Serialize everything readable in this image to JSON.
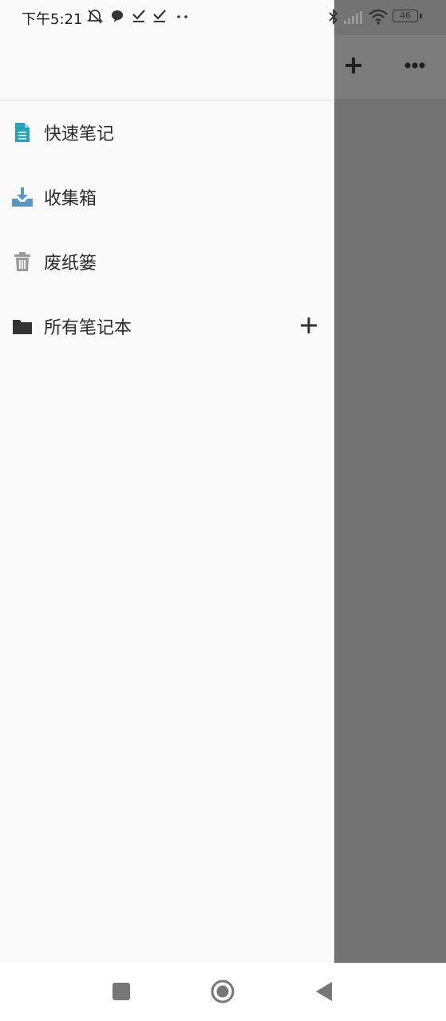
{
  "status_bar": {
    "time": "下午5:21",
    "battery": "46",
    "icons": [
      "mute-bell-icon",
      "chat-bubble-icon",
      "check-icon",
      "check-icon",
      "more-dots-icon",
      "bluetooth-icon",
      "signal-icon",
      "wifi-icon",
      "battery-icon"
    ]
  },
  "background_toolbar": {
    "icons": [
      "add-icon",
      "more-icon"
    ]
  },
  "drawer": {
    "items": [
      {
        "label": "快速笔记",
        "icon": "note-document-icon",
        "color": "#26a3b8"
      },
      {
        "label": "收集箱",
        "icon": "inbox-download-icon",
        "color": "#5b95c4"
      },
      {
        "label": "废纸篓",
        "icon": "trash-icon",
        "color": "#9a9a9a"
      },
      {
        "label": "所有笔记本",
        "icon": "folder-icon",
        "color": "#333333"
      }
    ]
  },
  "nav_bar": {
    "icons": [
      "recents-square-icon",
      "home-circle-icon",
      "back-triangle-icon"
    ]
  },
  "colors": {
    "scrim": "#737373",
    "drawer_bg": "#fafafa",
    "note_icon": "#26a3b8",
    "inbox_icon": "#5b95c4"
  }
}
